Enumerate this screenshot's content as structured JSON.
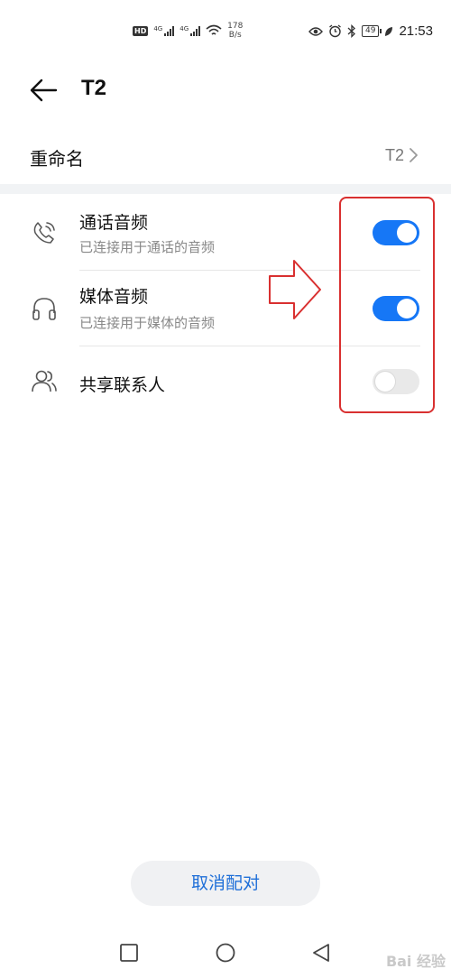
{
  "status_bar": {
    "hd": "HD",
    "sim1_network": "4G",
    "sim2_network": "4G",
    "speed_value": "178",
    "speed_unit": "B/s",
    "battery": "49",
    "time": "21:53"
  },
  "header": {
    "title": "T2"
  },
  "rename": {
    "label": "重命名",
    "value": "T2"
  },
  "settings": [
    {
      "title": "通话音频",
      "subtitle": "已连接用于通话的音频",
      "enabled": true,
      "icon": "phone-icon"
    },
    {
      "title": "媒体音频",
      "subtitle": "已连接用于媒体的音频",
      "enabled": true,
      "icon": "headphones-icon"
    },
    {
      "title": "共享联系人",
      "subtitle": "",
      "enabled": false,
      "icon": "contacts-icon"
    }
  ],
  "unpair_button": "取消配对",
  "watermark": "Bai 经验",
  "colors": {
    "accent": "#1677f6",
    "annotation": "#d93030",
    "toggle_off": "#e9e9e9"
  }
}
